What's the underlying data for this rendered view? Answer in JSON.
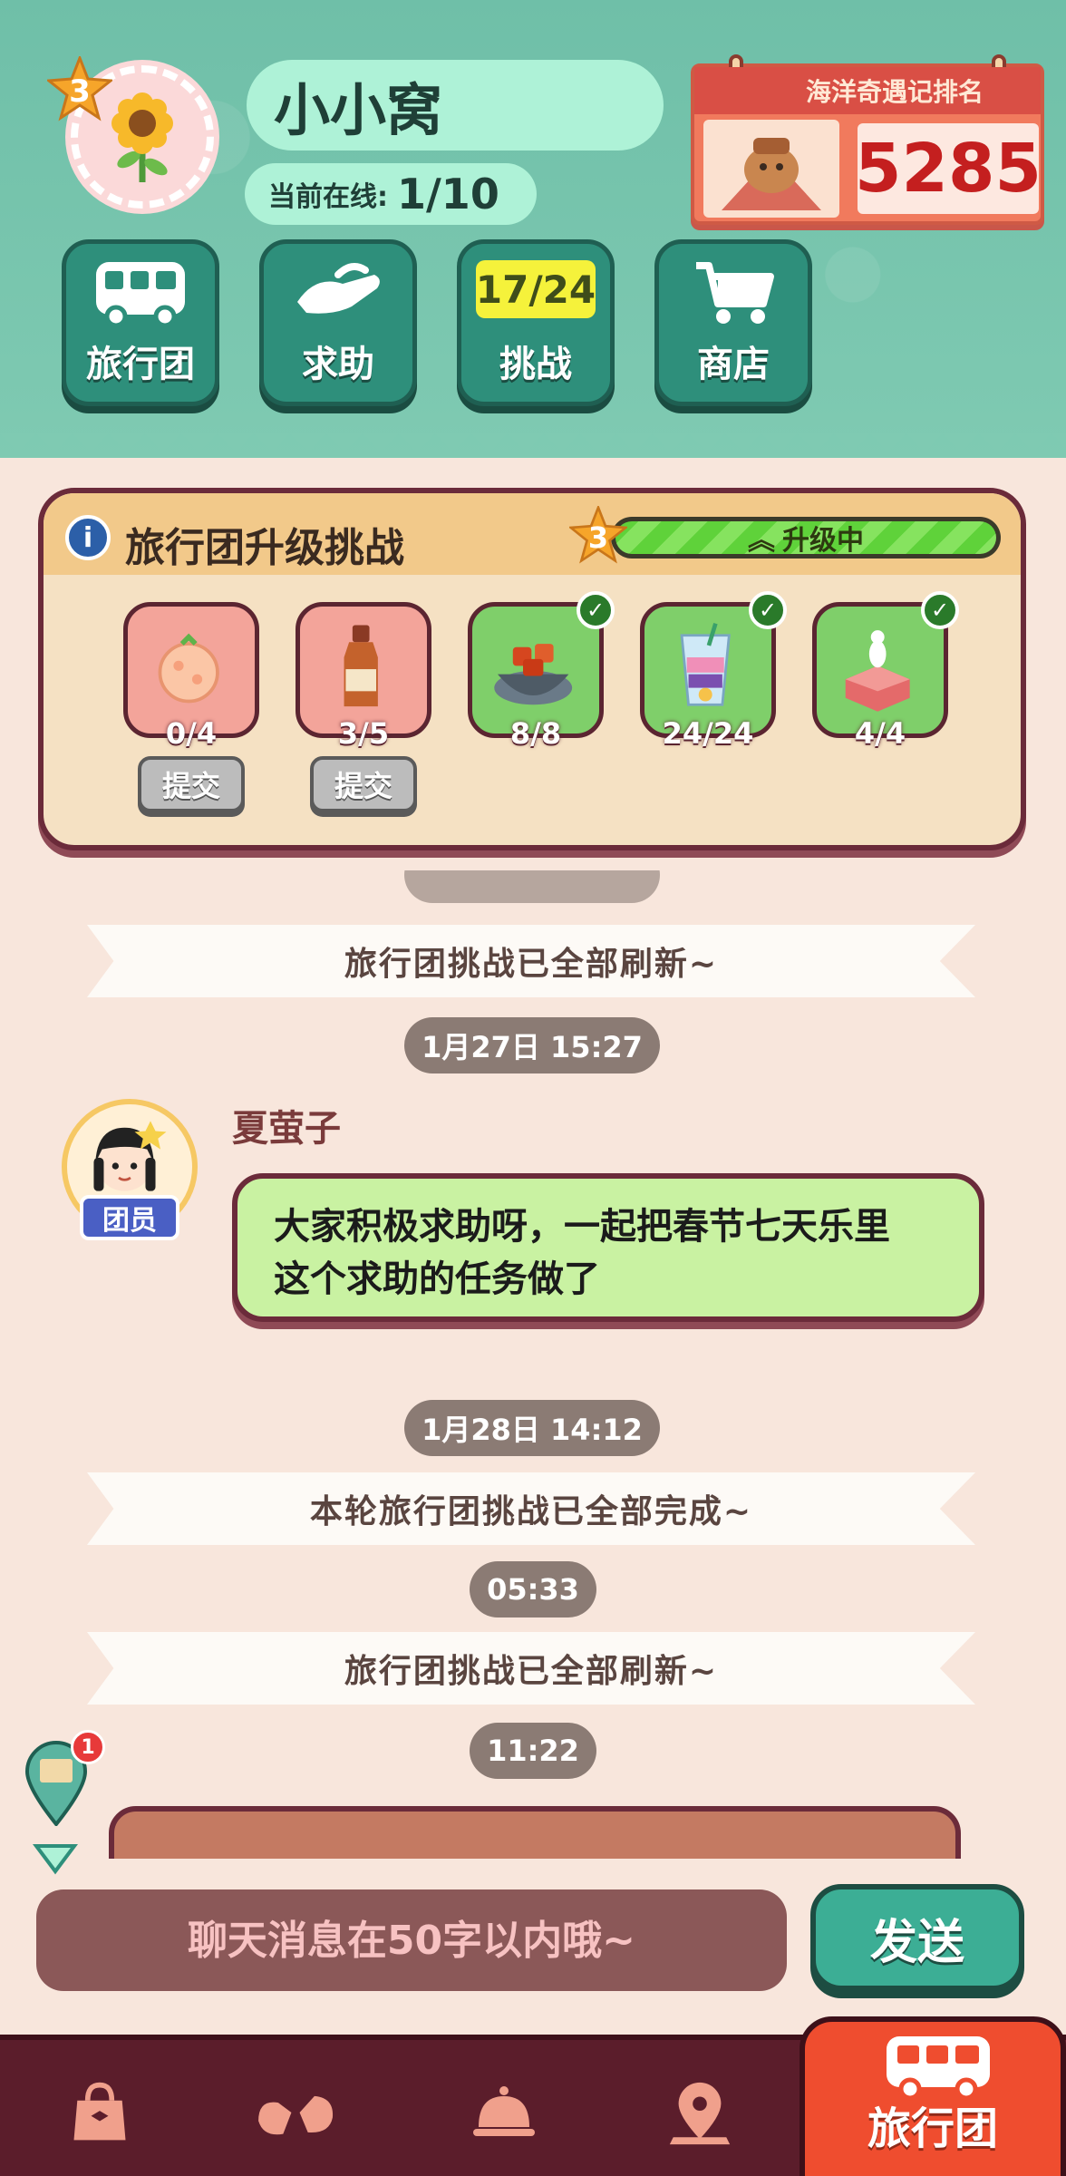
{
  "header": {
    "level": "3",
    "home_name": "小小窝",
    "online_label": "当前在线:",
    "online_value": "1/10",
    "ranking": {
      "title": "海洋奇遇记排名",
      "value": "5285"
    }
  },
  "top_buttons": [
    {
      "label": "旅行团",
      "icon": "bus-icon"
    },
    {
      "label": "求助",
      "icon": "helping-hand-icon"
    },
    {
      "label": "挑战",
      "icon": "challenge-icon",
      "counter": "17/24"
    },
    {
      "label": "商店",
      "icon": "shopping-cart-icon"
    }
  ],
  "challenge": {
    "title": "旅行团升级挑战",
    "level": "3",
    "status_label": "升级中",
    "items": [
      {
        "name": "pink-sweet-item",
        "count": "0/4",
        "done": false,
        "submit_label": "提交"
      },
      {
        "name": "sauce-bottle-item",
        "count": "3/5",
        "done": false,
        "submit_label": "提交"
      },
      {
        "name": "bowl-dish-item",
        "count": "8/8",
        "done": true
      },
      {
        "name": "parfait-item",
        "count": "24/24",
        "done": true
      },
      {
        "name": "cake-item",
        "count": "4/4",
        "done": true
      }
    ]
  },
  "chat": {
    "messages": [
      {
        "type": "system",
        "text": "旅行团挑战已全部刷新~"
      },
      {
        "type": "time",
        "text": "1月27日 15:27"
      },
      {
        "type": "user",
        "sender": "夏萤子",
        "role": "团员",
        "text_line1": "大家积极求助呀，一起把春节七天乐里",
        "text_line2": "这个求助的任务做了"
      },
      {
        "type": "time",
        "text": "1月28日 14:12"
      },
      {
        "type": "system",
        "text": "本轮旅行团挑战已全部完成~"
      },
      {
        "type": "time",
        "text": "05:33"
      },
      {
        "type": "system",
        "text": "旅行团挑战已全部刷新~"
      },
      {
        "type": "time",
        "text": "11:22"
      }
    ],
    "pin_badge_count": "1"
  },
  "input": {
    "placeholder": "聊天消息在50字以内哦~",
    "send_label": "发送"
  },
  "bottom_nav": {
    "items": [
      {
        "icon": "bag-icon"
      },
      {
        "icon": "friends-icon"
      },
      {
        "icon": "service-bell-icon"
      },
      {
        "icon": "map-pin-icon"
      }
    ],
    "active_label": "旅行团",
    "active_icon": "bus-icon"
  },
  "colors": {
    "header_teal": "#7fcab2",
    "panel_border": "#6b2b3a",
    "bubble_green": "#c9f2a2",
    "nav_bg": "#5b1d2b",
    "nav_active": "#ef4d2f",
    "send_green": "#3cae95"
  }
}
